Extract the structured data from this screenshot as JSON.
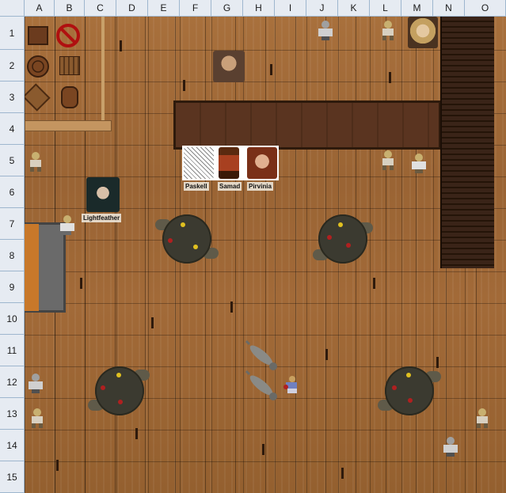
{
  "columns": [
    "A",
    "B",
    "C",
    "D",
    "E",
    "F",
    "G",
    "H",
    "I",
    "J",
    "K",
    "L",
    "M",
    "N",
    "O"
  ],
  "rows": [
    "1",
    "2",
    "3",
    "4",
    "5",
    "6",
    "7",
    "8",
    "9",
    "10",
    "11",
    "12",
    "13",
    "14",
    "15"
  ],
  "tokens": {
    "lightfeather": "Lightfeather",
    "paskell": "Paskell",
    "samad": "Samad",
    "pirvinia": "Pirvinia"
  },
  "colors": {
    "floor": "#9a6434",
    "bar": "#5a3420",
    "stairs": "#3a2418",
    "table": "#3b3a30",
    "header_bg": "#e6ebf2",
    "header_border": "#9eb6ce"
  },
  "icons": [
    "crate-icon",
    "no-entry-icon",
    "barrel-icon",
    "table-icon",
    "person-icon",
    "wolf-icon"
  ]
}
